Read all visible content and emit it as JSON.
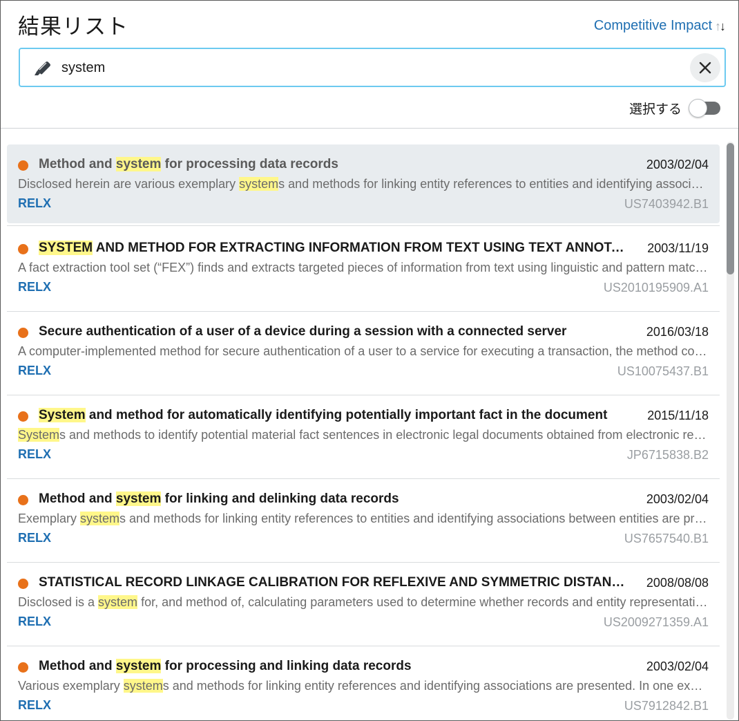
{
  "header": {
    "title": "結果リスト",
    "sort_label": "Competitive Impact",
    "sort_icon": "sort-desc-arrows"
  },
  "search": {
    "value": "system",
    "icon": "highlighter-icon",
    "clear_icon": "close-icon"
  },
  "select_toggle": {
    "label": "選択する",
    "on": false
  },
  "colors": {
    "accent": "#1f6fb2",
    "status_dot": "#e8711a",
    "highlight": "#fff78a",
    "search_border": "#6ccaf0"
  },
  "results": [
    {
      "title": "Method and system for processing data records",
      "date": "2003/02/04",
      "description": "Disclosed herein are various exemplary systems and methods for linking entity references to entities and identifying associations between entities",
      "company": "RELX",
      "id": "US7403942.B1",
      "selected": true
    },
    {
      "title": "SYSTEM AND METHOD FOR EXTRACTING INFORMATION FROM TEXT USING TEXT ANNOTATION AND FACT EXTRACTION",
      "date": "2003/11/19",
      "description": "A fact extraction tool set (“FEX”) finds and extracts targeted pieces of information from text using linguistic and pattern matching technologies",
      "company": "RELX",
      "id": "US2010195909.A1",
      "selected": false
    },
    {
      "title": "Secure authentication of a user of a device during a session with a connected server",
      "date": "2016/03/18",
      "description": "A computer-implemented method for secure authentication of a user to a service for executing a transaction, the method comprising",
      "company": "RELX",
      "id": "US10075437.B1",
      "selected": false
    },
    {
      "title": "System and method for automatically identifying potentially important fact in the document",
      "date": "2015/11/18",
      "description": "Systems and methods to identify potential material fact sentences in electronic legal documents obtained from electronic repositories",
      "company": "RELX",
      "id": "JP6715838.B2",
      "selected": false
    },
    {
      "title": "Method and system for linking and delinking data records",
      "date": "2003/02/04",
      "description": "Exemplary systems and methods for linking entity references to entities and identifying associations between entities are presented",
      "company": "RELX",
      "id": "US7657540.B1",
      "selected": false
    },
    {
      "title": "STATISTICAL RECORD LINKAGE CALIBRATION FOR REFLEXIVE AND SYMMETRIC DISTANCE MEASURES AT THE FIELD AND FIELD VALUE LEVELS",
      "date": "2008/08/08",
      "description": "Disclosed is a system for, and method of, calculating parameters used to determine whether records and entity representations should be linked",
      "company": "RELX",
      "id": "US2009271359.A1",
      "selected": false
    },
    {
      "title": "Method and system for processing and linking data records",
      "date": "2003/02/04",
      "description": "Various exemplary systems and methods for linking entity references and identifying associations are presented. In one example",
      "company": "RELX",
      "id": "US7912842.B1",
      "selected": false
    }
  ]
}
